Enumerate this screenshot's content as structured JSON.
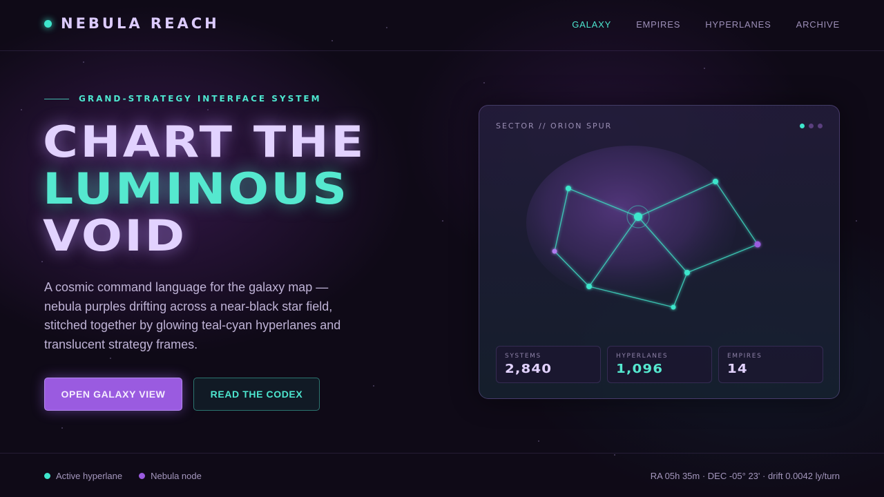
{
  "header": {
    "brand": "NEBULA REACH",
    "nav": [
      {
        "label": "GALAXY",
        "active": true
      },
      {
        "label": "EMPIRES",
        "active": false
      },
      {
        "label": "HYPERLANES",
        "active": false
      },
      {
        "label": "ARCHIVE",
        "active": false
      }
    ]
  },
  "hero": {
    "eyebrow": "GRAND-STRATEGY INTERFACE SYSTEM",
    "headline": [
      "CHART THE",
      "LUMINOUS",
      "VOID"
    ],
    "lede": "A cosmic command language for the galaxy map — nebula purples drifting across a near-black star field, stitched together by glowing teal-cyan hyperlanes and translucent strategy frames.",
    "primary_button": "OPEN GALAXY VIEW",
    "secondary_button": "READ THE CODEX"
  },
  "panel": {
    "title": "SECTOR // ORION SPUR",
    "stats": [
      {
        "label": "SYSTEMS",
        "value": "2,840"
      },
      {
        "label": "HYPERLANES",
        "value": "1,096"
      },
      {
        "label": "EMPIRES",
        "value": "14"
      }
    ]
  },
  "footer": {
    "legend_active": "Active hyperlane",
    "legend_node": "Nebula node",
    "coords": "RA 05h 35m · DEC -05° 23' · drift 0.0042 ly/turn"
  },
  "colors": {
    "teal": "#4de6cf",
    "nebula_purple": "#9a5be0",
    "lilac": "#e2d2ff",
    "background": "#0f0a17"
  }
}
